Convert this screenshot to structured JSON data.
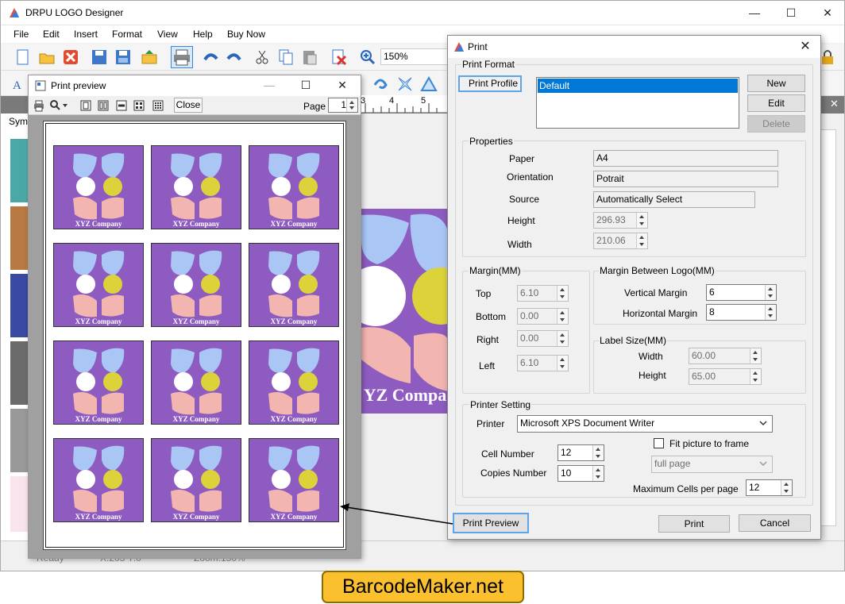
{
  "app": {
    "title": "DRPU LOGO Designer",
    "menu": [
      "File",
      "Edit",
      "Insert",
      "Format",
      "View",
      "Help",
      "Buy Now"
    ],
    "zoom": "150%",
    "symbols_tab": "Symb",
    "status": {
      "ready": "Ready",
      "size": "X:203  Y:0",
      "zoom": "Zoom:150%"
    },
    "canvas_caption": "YZ Compa"
  },
  "preview": {
    "title": "Print preview",
    "close_label": "Close",
    "page_label": "Page",
    "page_value": "1",
    "ruler_marks": [
      "3",
      "4",
      "5"
    ],
    "tile_caption": "XYZ Company",
    "tile_count": 12
  },
  "print": {
    "title": "Print",
    "print_format": "Print Format",
    "print_profile": "Print Profile",
    "profile_selected": "Default",
    "new": "New",
    "edit": "Edit",
    "delete": "Delete",
    "properties": "Properties",
    "paper_label": "Paper",
    "paper": "A4",
    "orientation_label": "Orientation",
    "orientation": "Potrait",
    "source_label": "Source",
    "source": "Automatically Select",
    "height_label": "Height",
    "height": "296.93",
    "width_label": "Width",
    "width": "210.06",
    "margin_title": "Margin(MM)",
    "top_label": "Top",
    "top": "6.10",
    "bottom_label": "Bottom",
    "bottom": "0.00",
    "right_label": "Right",
    "right": "0.00",
    "left_label": "Left",
    "left": "6.10",
    "mbl_title": "Margin Between Logo(MM)",
    "vm_label": "Vertical Margin",
    "vm": "6",
    "hm_label": "Horizontal Margin",
    "hm": "8",
    "label_size_title": "Label Size(MM)",
    "ls_width_label": "Width",
    "ls_width": "60.00",
    "ls_height_label": "Height",
    "ls_height": "65.00",
    "printer_setting": "Printer Setting",
    "printer_label": "Printer",
    "printer": "Microsoft XPS Document Writer",
    "fit_label": "Fit picture to frame",
    "full_page": "full page",
    "cell_label": "Cell Number",
    "cell": "12",
    "copies_label": "Copies Number",
    "copies": "10",
    "max_cells_label": "Maximum Cells per page",
    "max_cells": "12",
    "preview_btn": "Print Preview",
    "print_btn": "Print",
    "cancel_btn": "Cancel"
  },
  "watermark": "BarcodeMaker.net",
  "colors": {
    "tile_bg": "#8e5cc0",
    "petal_blue": "#a9c6f5",
    "petal_pink": "#f3b5b0",
    "yellow": "#dcd33a",
    "badge": "#fbc02d"
  }
}
